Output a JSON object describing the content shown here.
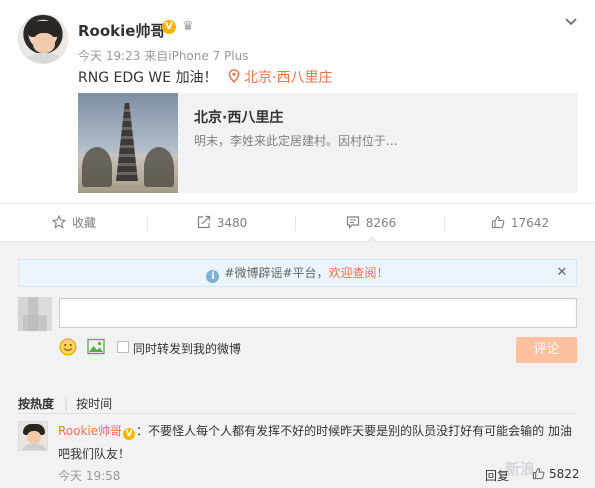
{
  "post": {
    "author": "Rookie帅哥",
    "verified_badge": "V",
    "badge_icon": "crown-icon",
    "time": "今天 19:23",
    "via_label": "来自",
    "device": "iPhone 7 Plus",
    "text": "RNG EDG WE 加油！",
    "location": "北京·西八里庄",
    "menu_icon": "chevron-down-icon"
  },
  "card": {
    "title": "北京·西八里庄",
    "description": "明末，李姓来此定居建村。因村位于..."
  },
  "actions": {
    "favorite_label": "收藏",
    "repost_count": "3480",
    "comment_count": "8266",
    "like_count": "17642"
  },
  "comment_box": {
    "notice_prefix": "#微博辟谣#平台，",
    "notice_link": "欢迎查阅！",
    "repost_checkbox_label": "同时转发到我的微博",
    "submit_label": "评论"
  },
  "sort": {
    "hot": "按热度",
    "time": "按时间"
  },
  "reply": {
    "author": "Rookie帅哥",
    "badge": "V",
    "text_line1": "：不要怪人每个人都有发挥不好的时候昨天要是别的队员没打好有可能会输的 加油",
    "text_line2": "吧我们队友！",
    "time": "今天 19:58",
    "reply_label": "回复",
    "like_count": "5822"
  },
  "colors": {
    "accent": "#eb7350",
    "verified": "#f7b500",
    "submit_disabled": "#ffc09f",
    "comment_bg": "#f2f2f5"
  }
}
